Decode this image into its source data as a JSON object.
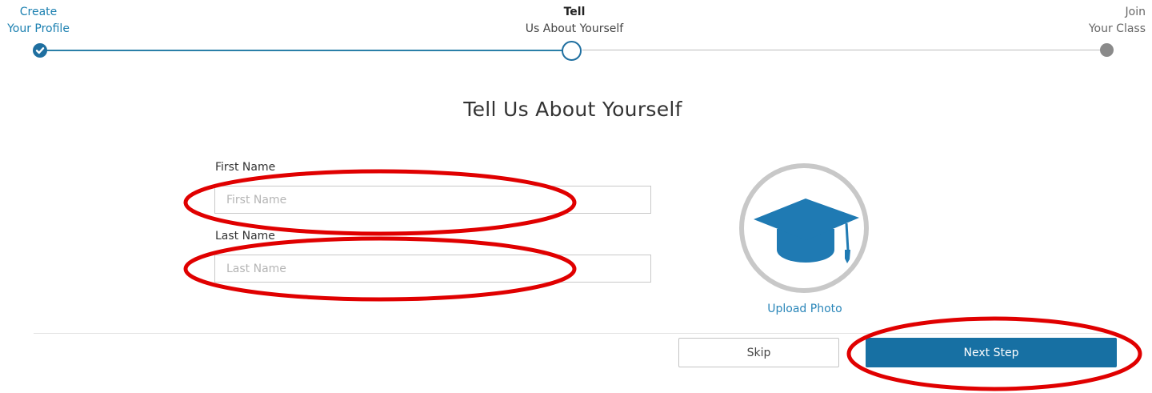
{
  "stepper": {
    "steps": [
      {
        "line1": "Create",
        "line2": "Your Profile",
        "status": "completed"
      },
      {
        "line1": "Tell",
        "line2": "Us About Yourself",
        "status": "current"
      },
      {
        "line1": "Join",
        "line2": "Your Class",
        "status": "upcoming"
      }
    ],
    "colors": {
      "active": "#1f6fa0",
      "upcoming": "#8a8a8a"
    }
  },
  "page": {
    "title": "Tell Us About Yourself"
  },
  "form": {
    "first_name": {
      "label": "First Name",
      "value": "",
      "placeholder": "First Name"
    },
    "last_name": {
      "label": "Last Name",
      "value": "",
      "placeholder": "Last Name"
    }
  },
  "photo": {
    "icon": "graduation-cap-icon",
    "upload_label": "Upload Photo"
  },
  "actions": {
    "skip_label": "Skip",
    "next_label": "Next Step",
    "primary_color": "#1770a3"
  },
  "annotations": {
    "type": "red-ellipse-highlight",
    "color": "#e00000"
  }
}
